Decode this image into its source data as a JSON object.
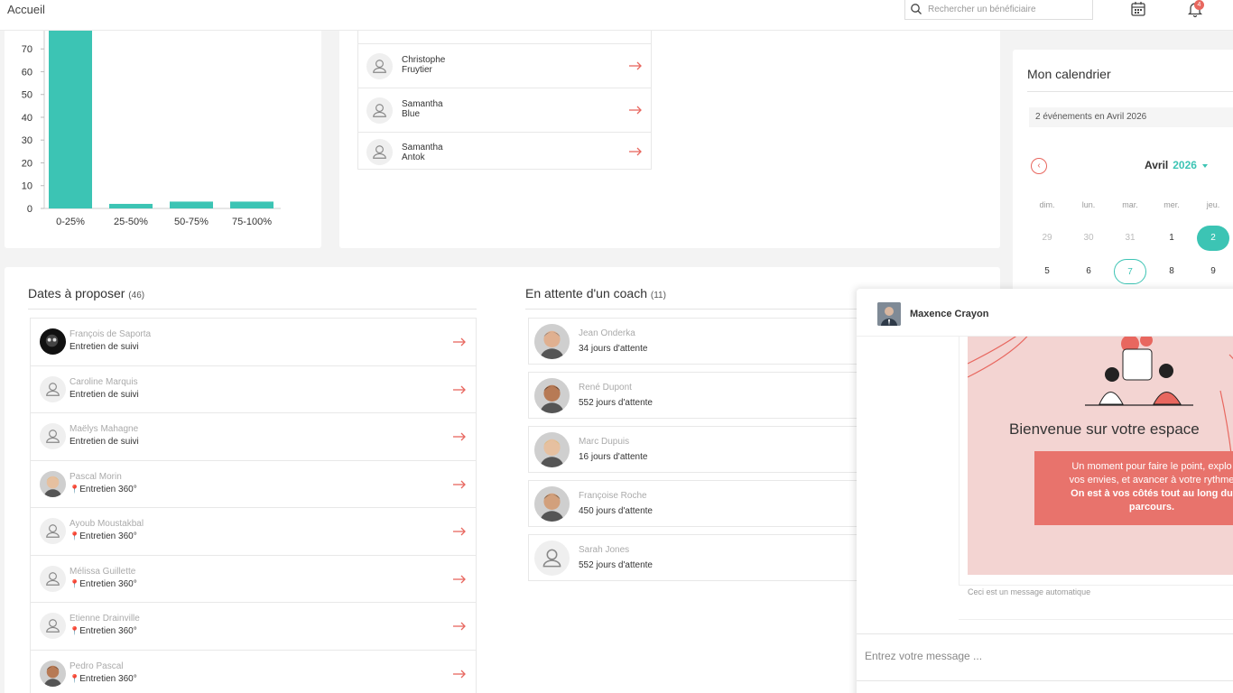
{
  "topbar": {
    "title": "Accueil",
    "search_placeholder": "Rechercher un bénéficiaire",
    "notification_count": "4"
  },
  "chart_data": {
    "type": "bar",
    "categories": [
      "0-25%",
      "25-50%",
      "50-75%",
      "75-100%"
    ],
    "values": [
      78,
      2,
      3,
      3
    ],
    "title": "",
    "xlabel": "",
    "ylabel": "",
    "ylim": [
      0,
      78
    ],
    "yticks": [
      0,
      10,
      20,
      30,
      40,
      50,
      60,
      70
    ],
    "color": "#3cc4b4"
  },
  "top_list": {
    "items": [
      {
        "first": "Christophe",
        "last": "Fruytier"
      },
      {
        "first": "Samantha",
        "last": "Blue"
      },
      {
        "first": "Samantha",
        "last": "Antok"
      }
    ]
  },
  "dates_section": {
    "title": "Dates à proposer",
    "count": "(46)",
    "items": [
      {
        "name": "François de Saporta",
        "type": "Entretien de suivi",
        "pin": false,
        "avatar": "photo-dark"
      },
      {
        "name": "Caroline Marquis",
        "type": "Entretien de suivi",
        "pin": false,
        "avatar": "placeholder"
      },
      {
        "name": "Maëlys Mahagne",
        "type": "Entretien de suivi",
        "pin": false,
        "avatar": "placeholder"
      },
      {
        "name": "Pascal Morin",
        "type": "Entretien 360°",
        "pin": true,
        "avatar": "photo"
      },
      {
        "name": "Ayoub Moustakbal",
        "type": "Entretien 360°",
        "pin": true,
        "avatar": "placeholder"
      },
      {
        "name": "Mélissa Guillette",
        "type": "Entretien 360°",
        "pin": true,
        "avatar": "placeholder"
      },
      {
        "name": "Etienne Drainville",
        "type": "Entretien 360°",
        "pin": true,
        "avatar": "placeholder"
      },
      {
        "name": "Pedro Pascal",
        "type": "Entretien 360°",
        "pin": true,
        "avatar": "photo"
      }
    ]
  },
  "waiting_section": {
    "title": "En attente d'un coach",
    "count": "(11)",
    "items": [
      {
        "name": "Jean Onderka",
        "wait": "34 jours d'attente",
        "avatar": "photo"
      },
      {
        "name": "René Dupont",
        "wait": "552 jours d'attente",
        "avatar": "photo"
      },
      {
        "name": "Marc Dupuis",
        "wait": "16 jours d'attente",
        "avatar": "photo"
      },
      {
        "name": "Françoise Roche",
        "wait": "450 jours d'attente",
        "avatar": "photo"
      },
      {
        "name": "Sarah Jones",
        "wait": "552 jours d'attente",
        "avatar": "placeholder"
      }
    ]
  },
  "calendar": {
    "title": "Mon calendrier",
    "events_summary": "2 événements en Avril 2026",
    "month": "Avril",
    "year": "2026",
    "weekdays": [
      "dim.",
      "lun.",
      "mar.",
      "mer.",
      "jeu."
    ],
    "rows": [
      [
        "29",
        "30",
        "31",
        "1",
        "2"
      ],
      [
        "5",
        "6",
        "7",
        "8",
        "9"
      ]
    ],
    "selected_day": "2",
    "today_day": "7"
  },
  "chat": {
    "contact_name": "Maxence Crayon",
    "welcome_title": "Bienvenue sur votre espace",
    "welcome_line1": "Un moment pour faire le point, explo",
    "welcome_line2": "vos envies, et avancer à votre rythme",
    "welcome_bold1": "On est à vos côtés tout au long du",
    "welcome_bold2": "parcours.",
    "auto_message": "Ceci est un message automatique",
    "input_placeholder": "Entrez votre message ..."
  },
  "colors": {
    "accent": "#3cc4b4",
    "arrow": "#e8675f",
    "welcome_bg": "#f3d4d2",
    "welcome_box": "#e8736c"
  }
}
